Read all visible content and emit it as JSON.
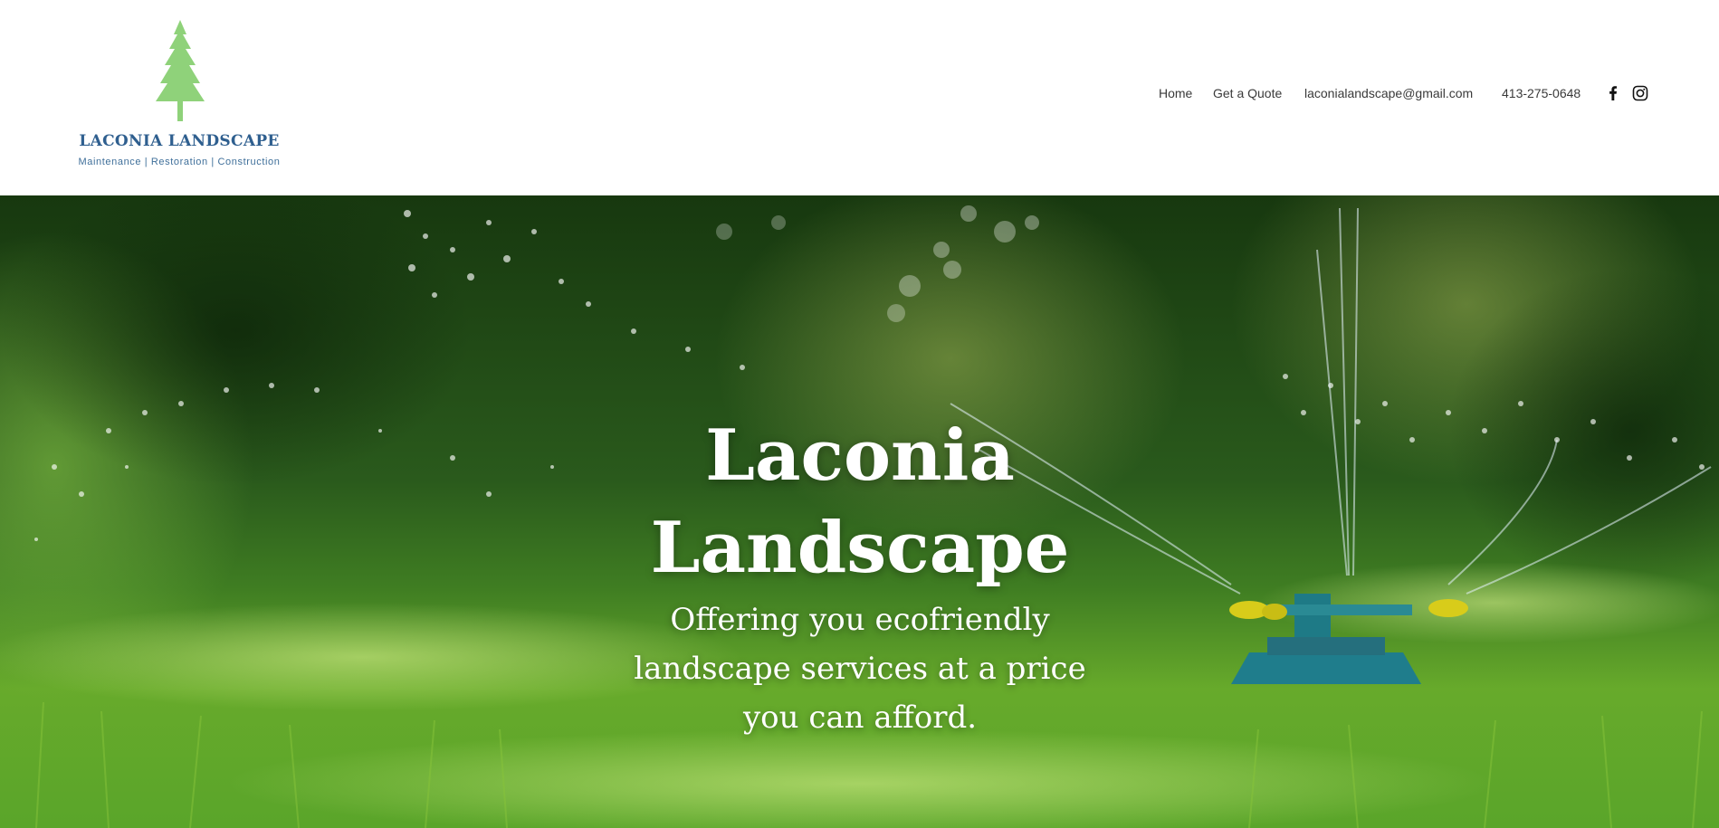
{
  "brand": {
    "name": "LACONIA LANDSCAPE",
    "tagline": "Maintenance | Restoration | Construction",
    "colors": {
      "tree": "#8fd27a",
      "text": "#2f5f8f"
    }
  },
  "nav": {
    "items": [
      {
        "label": "Home"
      },
      {
        "label": "Get a Quote"
      }
    ],
    "email": "laconialandscape@gmail.com",
    "phone": "413-275-0648",
    "social": [
      {
        "icon": "facebook-icon"
      },
      {
        "icon": "instagram-icon"
      }
    ]
  },
  "hero": {
    "title": "Laconia Landscape",
    "subtitle": "Offering you ecofriendly landscape services at a price you can afford.",
    "colors": {
      "text": "#ffffff",
      "grass": "#6fbe2c",
      "foliage": "#1f4a1a"
    }
  }
}
